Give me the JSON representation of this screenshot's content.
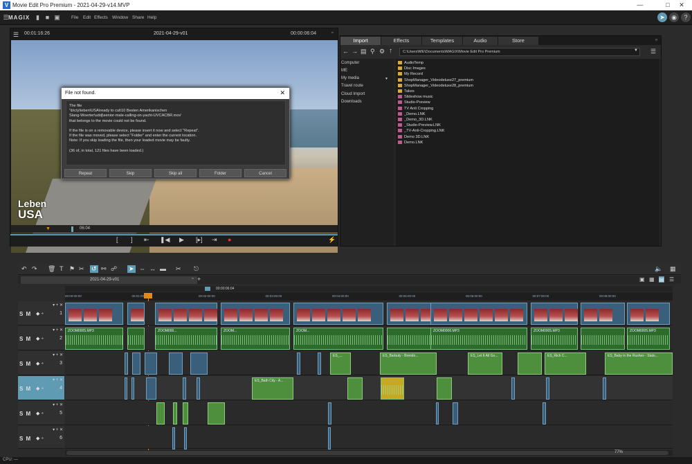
{
  "window": {
    "title": "Movie Edit Pro Premium - 2021-04-29-v14.MVP"
  },
  "menu": {
    "logo": "MAGIX",
    "items": [
      "File",
      "Edit",
      "Effects",
      "Window",
      "Share",
      "Help"
    ]
  },
  "preview": {
    "timecode_left": "00:01:16:26",
    "project": "2021-04-29-v01",
    "timecode_right": "00:00:06:04",
    "scrub_time": "06:04",
    "logo_line1": "Leben",
    "logo_line2": "USA"
  },
  "dialog": {
    "title": "File not found.",
    "message": "The file\n'\\b\\cty\\leben\\USA\\ready to cut\\10 Besten Amerikanischen\nSlang-Woerter\\uddj\\senior-male-calling-on-yacht-UVCACBR.mov'\nthat belongs to the movie could not be found.\n\nIf the file is on a removable device, please insert it now and select \"Repeat\".\nIf the file was moved, please select \"Folder\" and enter the current location.\nNote: If you skip loading the file, then your loaded movie may be faulty.\n\n(36 of, in total, 121 files have been loaded.)",
    "buttons": [
      "Repeat",
      "Skip",
      "Skip all",
      "Folder",
      "Cancel"
    ]
  },
  "pool": {
    "tabs": [
      "Import",
      "Effects",
      "Templates",
      "Audio",
      "Store"
    ],
    "path": "C:\\Users\\ME\\Documents\\MAGIX\\Movie Edit Pro Premium",
    "nav": [
      "Computer",
      "ME",
      "My media",
      "Travel route",
      "Cloud Import",
      "Downloads"
    ],
    "files": [
      {
        "name": "AudioTemp",
        "type": "folder"
      },
      {
        "name": "Disc Images",
        "type": "folder"
      },
      {
        "name": "My Record",
        "type": "folder"
      },
      {
        "name": "ShopManager_Videodeluxe27_premium",
        "type": "folder"
      },
      {
        "name": "ShopManager_Videodeluxe28_premium",
        "type": "folder"
      },
      {
        "name": "Takes",
        "type": "folder"
      },
      {
        "name": "Slideshow music",
        "type": "link"
      },
      {
        "name": "Studio-Preview",
        "type": "link"
      },
      {
        "name": "TV Anti Cropping",
        "type": "link"
      },
      {
        "name": "_Demo.LNK",
        "type": "link"
      },
      {
        "name": "_Demo_3D.LNK",
        "type": "link"
      },
      {
        "name": "_Studio-Preview.LNK",
        "type": "link"
      },
      {
        "name": "_TV-Anti-Cropping.LNK",
        "type": "link"
      },
      {
        "name": "Demo 3D.LNK",
        "type": "link"
      },
      {
        "name": "Demo.LNK",
        "type": "link"
      }
    ]
  },
  "timeline": {
    "tab": "2021-04-29-v01",
    "position": "00:00:06:04",
    "ruler": [
      "00:00:00:00",
      "00:01:00:00",
      "00:02:00:00",
      "00:03:00:00",
      "00:04:00:00",
      "00:05:00:00",
      "00:06:00:00",
      "00:07:00:00",
      "00:08:00:00"
    ],
    "track_controls": "S M",
    "track_numbers": [
      "1",
      "2",
      "3",
      "4",
      "5",
      "6"
    ],
    "audio_labels": [
      "ZOOM0005.MP3",
      "ZOOM000...",
      "ZOOM...",
      "ZOOM...",
      "ZOOM0006.MP3",
      "ZOOM0005.MP3",
      "ZOOM0005.MP3"
    ],
    "music_labels": [
      "ES_...",
      "ES_Barbuty - Brendo...",
      "ES_Let It All Go...",
      "ES_Rich C...",
      "ES_Baby in the Rushes - Stalo...",
      "ES_Bath City - A..."
    ],
    "zoom": "77%"
  },
  "status": {
    "cpu": "CPU: —"
  },
  "colors": {
    "accent": "#5f9bb3",
    "playhead": "#e08a1a",
    "audio": "#2d6b2d",
    "video": "#3a5f7a"
  }
}
